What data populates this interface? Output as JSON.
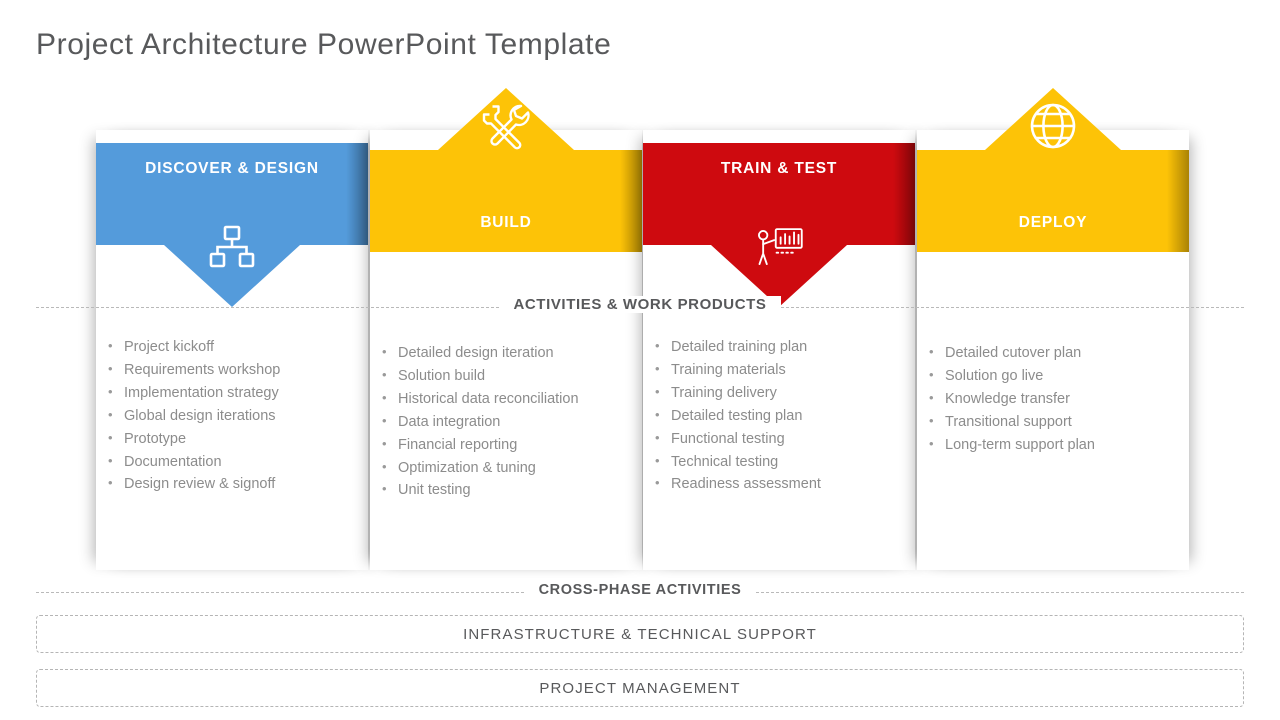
{
  "title": "Project Architecture PowerPoint Template",
  "colors": {
    "blue": "#549BDB",
    "yellow": "#FDC307",
    "red": "#CE0A0F",
    "text_gray": "#8c8c8c",
    "heading_gray": "#58595b",
    "dashed_gray": "#b5b5b5"
  },
  "section_divider": {
    "label": "ACTIVITIES & WORK PRODUCTS"
  },
  "phases": [
    {
      "label": "DISCOVER & DESIGN",
      "color": "#549BDB",
      "chevron": "down",
      "icon": "org-chart-icon",
      "items": [
        "Project kickoff",
        "Requirements workshop",
        "Implementation strategy",
        "Global design iterations",
        "Prototype",
        "Documentation",
        "Design review & signoff"
      ]
    },
    {
      "label": "BUILD",
      "color": "#FDC307",
      "chevron": "up",
      "icon": "tools-icon",
      "items": [
        "Detailed design iteration",
        "Solution build",
        "Historical data reconciliation",
        "Data integration",
        "Financial reporting",
        "Optimization & tuning",
        "Unit testing"
      ]
    },
    {
      "label": "TRAIN & TEST",
      "color": "#CE0A0F",
      "chevron": "down",
      "icon": "presenter-icon",
      "items": [
        "Detailed training plan",
        "Training materials",
        "Training delivery",
        "Detailed testing plan",
        "Functional testing",
        "Technical testing",
        "Readiness assessment"
      ]
    },
    {
      "label": "DEPLOY",
      "color": "#FDC307",
      "chevron": "up",
      "icon": "globe-icon",
      "items": [
        "Detailed cutover plan",
        "Solution go live",
        "Knowledge transfer",
        "Transitional support",
        "Long-term support plan"
      ]
    }
  ],
  "cross_phase": {
    "label": "CROSS-PHASE  ACTIVITIES",
    "bars": [
      "INFRASTRUCTURE  & TECHNICAL SUPPORT",
      "PROJECT MANAGEMENT"
    ]
  }
}
